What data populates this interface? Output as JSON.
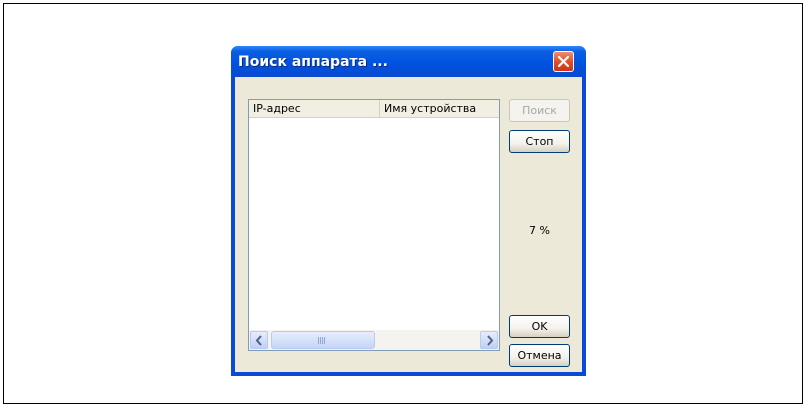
{
  "window": {
    "title": "Поиск аппарата ..."
  },
  "list": {
    "columns": [
      "IP-адрес",
      "Имя устройства"
    ]
  },
  "buttons": {
    "search": "Поиск",
    "stop": "Стоп",
    "ok": "OK",
    "cancel": "Отмена"
  },
  "status": {
    "progress": "7 %"
  },
  "icons": {
    "close": "close-icon",
    "scroll_left": "chevron-left-icon",
    "scroll_right": "chevron-right-icon"
  },
  "colors": {
    "titlebar": "#0052e0",
    "close": "#e3502d",
    "dialog_bg": "#ece9d8"
  }
}
